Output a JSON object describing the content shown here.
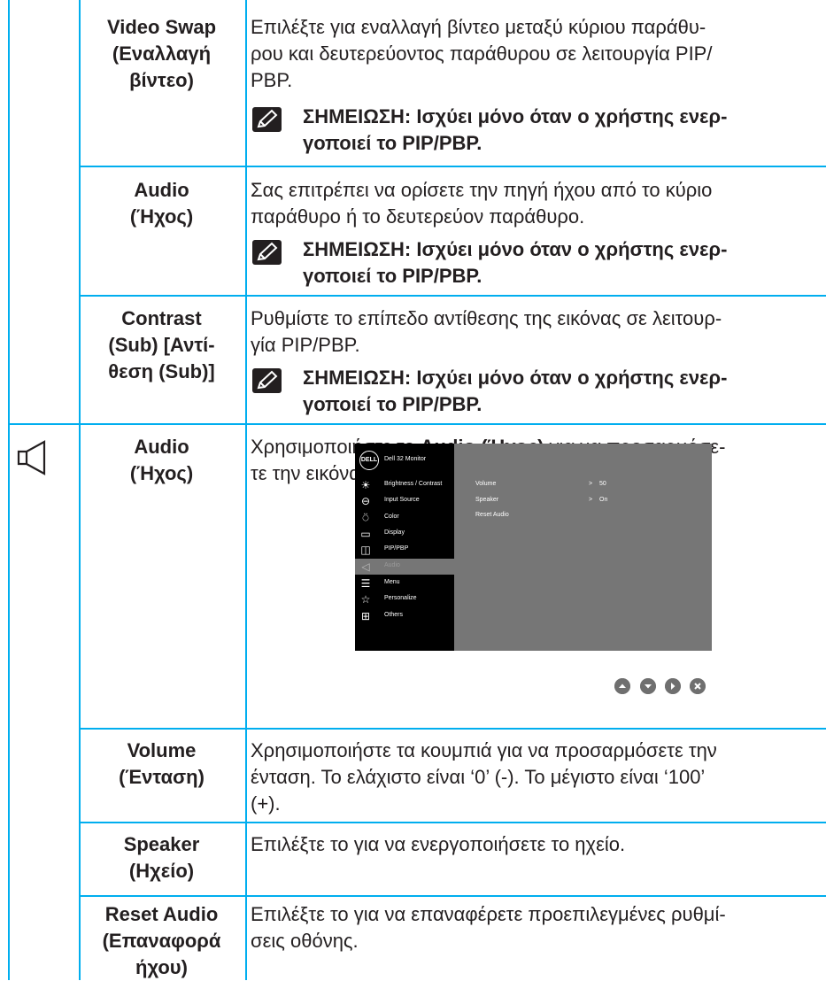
{
  "rows": [
    {
      "name_lines": [
        "Video Swap",
        "(Εναλλαγή",
        "βίντεο)"
      ],
      "desc_lines": [
        "Επιλέξτε για εναλλαγή βίντεο μεταξύ κύριου παράθυ-",
        "ρου και δευτερεύοντος παράθυρου σε λειτουργία PIP/",
        "PBP."
      ],
      "note_lines": [
        "ΣΗΜΕΙΩΣΗ: Ισχύει μόνο όταν ο χρήστης ενερ-",
        "γοποιεί το PIP/PBP."
      ]
    },
    {
      "name_lines": [
        "Audio",
        "(Ήχος)"
      ],
      "desc_lines": [
        "Σας επιτρέπει να ορίσετε την πηγή ήχου από το κύριο",
        "παράθυρο ή το δευτερεύον παράθυρο."
      ],
      "note_lines": [
        "ΣΗΜΕΙΩΣΗ: Ισχύει μόνο όταν ο χρήστης ενερ-",
        "γοποιεί το PIP/PBP."
      ]
    },
    {
      "name_lines": [
        "Contrast",
        "(Sub) [Αντί-",
        "θεση (Sub)]"
      ],
      "desc_lines": [
        "Ρυθμίστε το επίπεδο αντίθεσης της εικόνας σε λειτουρ-",
        "γία PIP/PBP."
      ],
      "note_lines": [
        "ΣΗΜΕΙΩΣΗ: Ισχύει μόνο όταν ο χρήστης ενερ-",
        "γοποιεί το PIP/PBP."
      ]
    },
    {
      "icon": "speaker-icon",
      "name_lines": [
        "Audio",
        "(Ήχος)"
      ],
      "desc_line1": {
        "before": "Χρησιμοποιήστε το ",
        "bold": "Audio (Ήχος)",
        "after": " για να προσαρμόσε-"
      },
      "desc_line2": "τε την εικόνα."
    },
    {
      "name_lines": [
        "Volume",
        "(Ένταση)"
      ],
      "desc_lines": [
        "Χρησιμοποιήστε τα κουμπιά για να προσαρμόσετε την",
        "ένταση. Το ελάχιστο είναι ‘0’ (-). Το μέγιστο είναι ‘100’",
        "(+)."
      ]
    },
    {
      "name_lines": [
        "Speaker",
        "(Ηχείο)"
      ],
      "desc_lines": [
        "Επιλέξτε το για να ενεργοποιήσετε το ηχείο."
      ]
    },
    {
      "name_lines": [
        "Reset Audio",
        "(Επαναφορά",
        "ήχου)"
      ],
      "desc_lines": [
        "Επιλέξτε το για να επαναφέρετε προεπιλεγμένες ρυθμί-",
        "σεις οθόνης."
      ]
    }
  ],
  "osd": {
    "logo": "DELL",
    "title": "Dell 32 Monitor",
    "menu": [
      {
        "icon": "brightness-icon",
        "label": "Brightness / Contrast"
      },
      {
        "icon": "input-source-icon",
        "label": "Input Source"
      },
      {
        "icon": "color-icon",
        "label": "Color"
      },
      {
        "icon": "display-icon",
        "label": "Display"
      },
      {
        "icon": "pip-pbp-icon",
        "label": "PIP/PBP"
      },
      {
        "icon": "audio-icon",
        "label": "Audio",
        "selected": true
      },
      {
        "icon": "menu-icon",
        "label": "Menu"
      },
      {
        "icon": "personalize-icon",
        "label": "Personalize"
      },
      {
        "icon": "others-icon",
        "label": "Others"
      }
    ],
    "settings": [
      {
        "label": "Volume",
        "arrow": ">",
        "value": "50"
      },
      {
        "label": "Speaker",
        "arrow": ">",
        "value": "On"
      },
      {
        "label": "Reset Audio",
        "arrow": "",
        "value": ""
      }
    ],
    "buttons": [
      "up-icon",
      "down-icon",
      "right-icon",
      "close-icon"
    ]
  },
  "colors": {
    "rule": "#00aeef",
    "text": "#231f20",
    "osd_bg": "#767676",
    "osd_sidebar": "#000000"
  }
}
